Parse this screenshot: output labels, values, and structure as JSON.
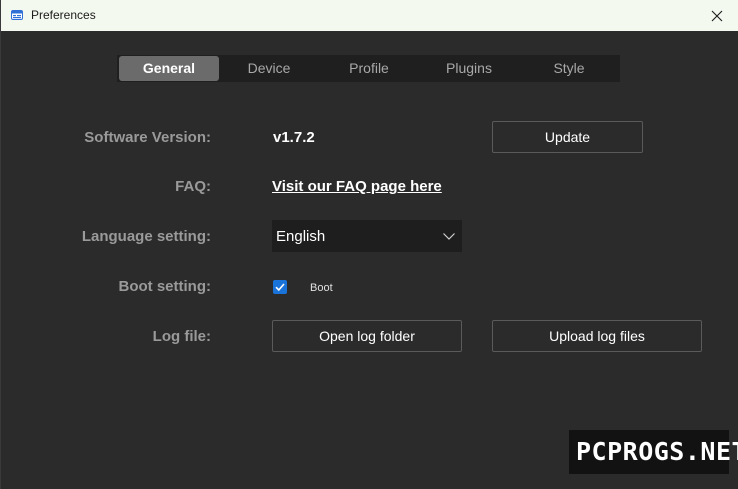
{
  "window": {
    "title": "Preferences",
    "icons": {
      "app": "app-window-icon",
      "close": "close-icon"
    }
  },
  "tabs": [
    {
      "label": "General",
      "active": true
    },
    {
      "label": "Device",
      "active": false
    },
    {
      "label": "Profile",
      "active": false
    },
    {
      "label": "Plugins",
      "active": false
    },
    {
      "label": "Style",
      "active": false
    }
  ],
  "settings": {
    "software_version": {
      "label": "Software Version:",
      "value": "v1.7.2",
      "button": "Update"
    },
    "faq": {
      "label": "FAQ:",
      "link": "Visit our FAQ page here"
    },
    "language": {
      "label": "Language setting:",
      "selected": "English",
      "icon": "chevron-down-icon"
    },
    "boot": {
      "label": "Boot setting:",
      "checkbox_label": "Boot",
      "checked": true,
      "icon": "checkmark-icon"
    },
    "log": {
      "label": "Log file:",
      "open_button": "Open log folder",
      "upload_button": "Upload log files"
    }
  },
  "watermark": {
    "text": "PCPROGS.NET"
  },
  "colors": {
    "background": "#2b2b2b",
    "titlebar": "#f3f9ee",
    "tab_bar": "#1f1f1f",
    "tab_active": "#6b6b6b",
    "accent_checkbox": "#1a73d9",
    "label_text": "#9a9a9a"
  }
}
